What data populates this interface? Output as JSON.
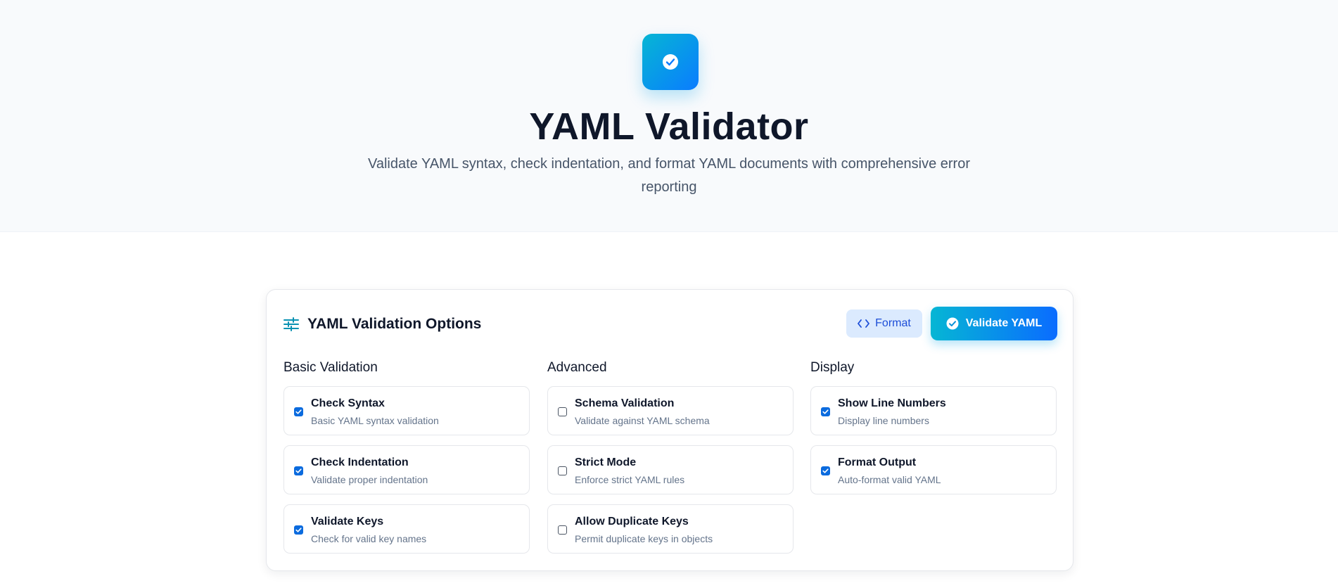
{
  "header": {
    "title": "YAML Validator",
    "subtitle": "Validate YAML syntax, check indentation, and format YAML documents with comprehensive error reporting",
    "logo_icon": "check-circle-icon",
    "accent_gradient": [
      "#06b6d4",
      "#0a7cff"
    ]
  },
  "options_panel": {
    "title": "YAML Validation Options",
    "title_icon": "sliders-icon",
    "format_button": "Format",
    "format_icon": "code-brackets-icon",
    "validate_button": "Validate YAML",
    "validate_icon": "check-circle-icon",
    "columns": [
      {
        "heading": "Basic Validation",
        "options": [
          {
            "label": "Check Syntax",
            "description": "Basic YAML syntax validation",
            "checked": true
          },
          {
            "label": "Check Indentation",
            "description": "Validate proper indentation",
            "checked": true
          },
          {
            "label": "Validate Keys",
            "description": "Check for valid key names",
            "checked": true
          }
        ]
      },
      {
        "heading": "Advanced",
        "options": [
          {
            "label": "Schema Validation",
            "description": "Validate against YAML schema",
            "checked": false
          },
          {
            "label": "Strict Mode",
            "description": "Enforce strict YAML rules",
            "checked": false
          },
          {
            "label": "Allow Duplicate Keys",
            "description": "Permit duplicate keys in objects",
            "checked": false
          }
        ]
      },
      {
        "heading": "Display",
        "options": [
          {
            "label": "Show Line Numbers",
            "description": "Display line numbers",
            "checked": true
          },
          {
            "label": "Format Output",
            "description": "Auto-format valid YAML",
            "checked": true
          }
        ]
      }
    ]
  }
}
